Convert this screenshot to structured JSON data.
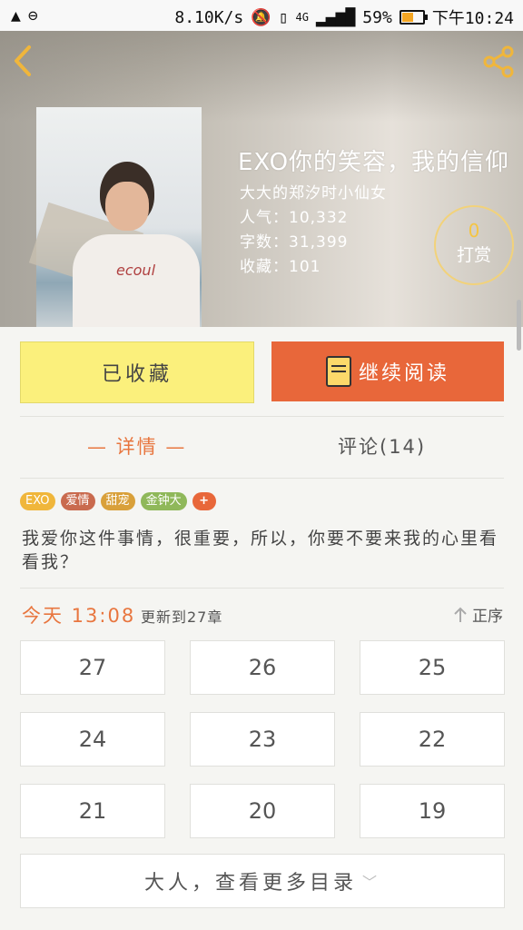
{
  "status_bar": {
    "speed": "8.10K/s",
    "network": "4G",
    "battery": "59%",
    "battery_level": 0.59,
    "time": "下午10:24"
  },
  "book": {
    "title": "EXO你的笑容，我的信仰",
    "author": "大大的郑汐时小仙女",
    "popularity": "人气：10,332",
    "word_count": "字数：31,399",
    "favorites": "收藏：101"
  },
  "reward": {
    "count": "0",
    "label": "打赏"
  },
  "actions": {
    "collected": "已收藏",
    "continue_reading": "继续阅读"
  },
  "tabs": {
    "detail": "— 详情 —",
    "comments": "评论(14)"
  },
  "tags": [
    "EXO",
    "爱情",
    "甜宠",
    "金钟大"
  ],
  "tag_add": "+",
  "description": "我爱你这件事情，很重要，所以，你要不要来我的心里看看我？",
  "update": {
    "time": "今天 13:08",
    "note": "更新到27章",
    "sort_label": "正序"
  },
  "chapters": [
    "27",
    "26",
    "25",
    "24",
    "23",
    "22",
    "21",
    "20",
    "19"
  ],
  "more_catalog": "大人，查看更多目录",
  "cover_text": "ecoul",
  "colors": {
    "accent": "#e8763f",
    "collect_bg": "#fbf07c",
    "read_bg": "#e8673a",
    "gold": "#f0b63b"
  }
}
